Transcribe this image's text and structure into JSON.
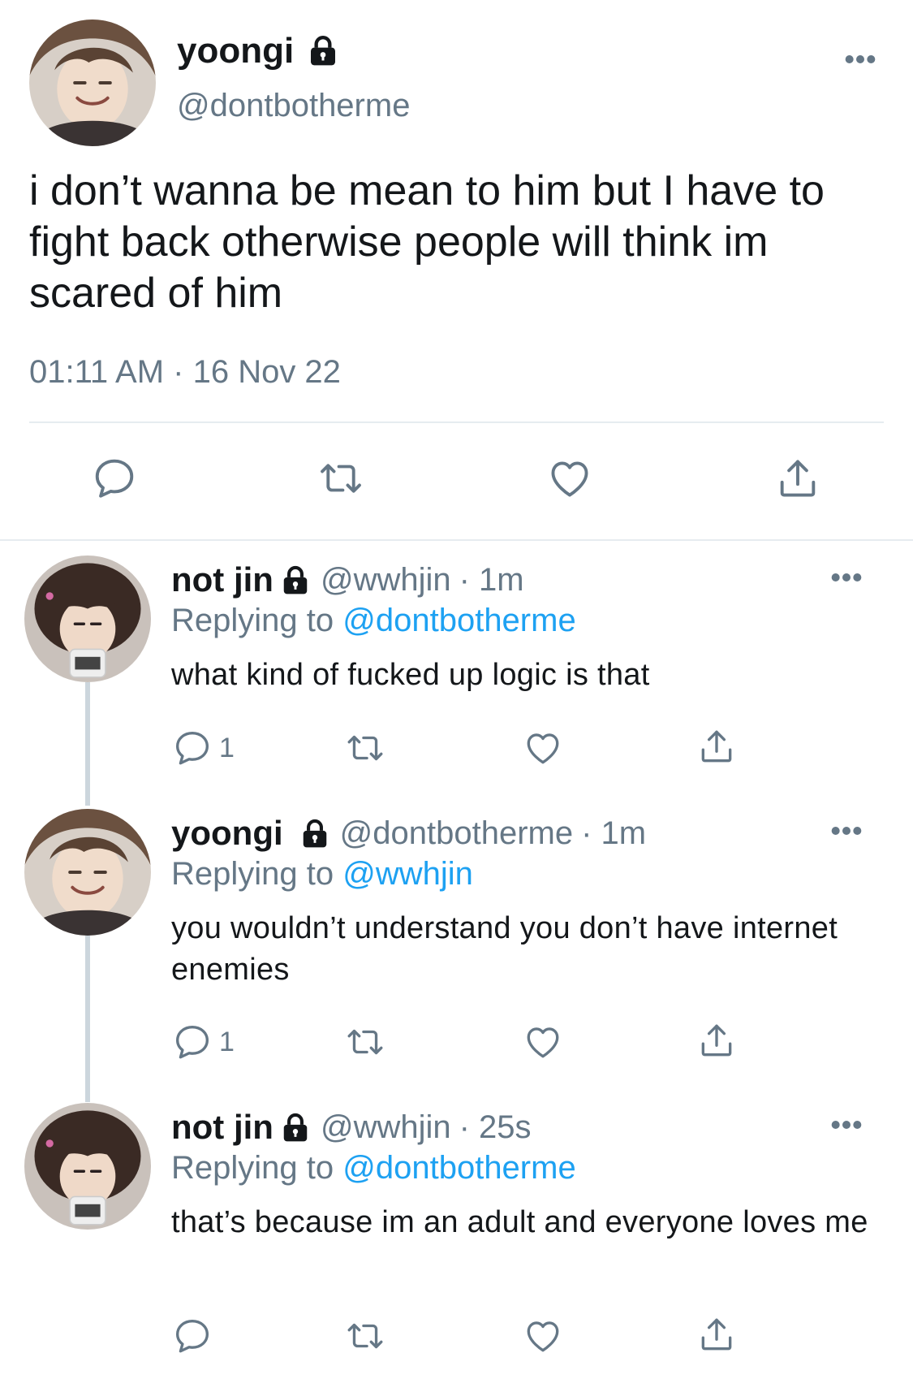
{
  "main_tweet": {
    "name": "yoongi",
    "handle": "@dontbotherme",
    "text": "i don’t wanna be mean to him but I have to fight back otherwise people will think im scared of him",
    "timestamp": "01:11 AM · 16 Nov 22"
  },
  "replies": [
    {
      "name": "not jin",
      "handle": "@wwhjin",
      "time": "· 1m",
      "replying_prefix": "Replying to",
      "replying_to": "@dontbotherme",
      "text": "what kind of fucked up logic is that",
      "reply_count": "1"
    },
    {
      "name": "yoongi",
      "handle": "@dontbotherme",
      "time": "· 1m",
      "replying_prefix": "Replying to",
      "replying_to": "@wwhjin",
      "text": "you wouldn’t understand you don’t have internet enemies",
      "reply_count": "1"
    },
    {
      "name": "not jin",
      "handle": "@wwhjin",
      "time": "· 25s",
      "replying_prefix": "Replying to",
      "replying_to": "@dontbotherme",
      "text": "that’s because im an adult and everyone loves me",
      "reply_count": ""
    }
  ],
  "icons": {
    "reply": "reply-icon",
    "retweet": "retweet-icon",
    "like": "heart-icon",
    "share": "share-icon",
    "lock": "lock-icon",
    "more": "more-icon"
  },
  "colors": {
    "link": "#1da1f2",
    "secondary_text": "#657786",
    "divider": "#e6ecf0",
    "thread_line": "#ccd6dd"
  }
}
